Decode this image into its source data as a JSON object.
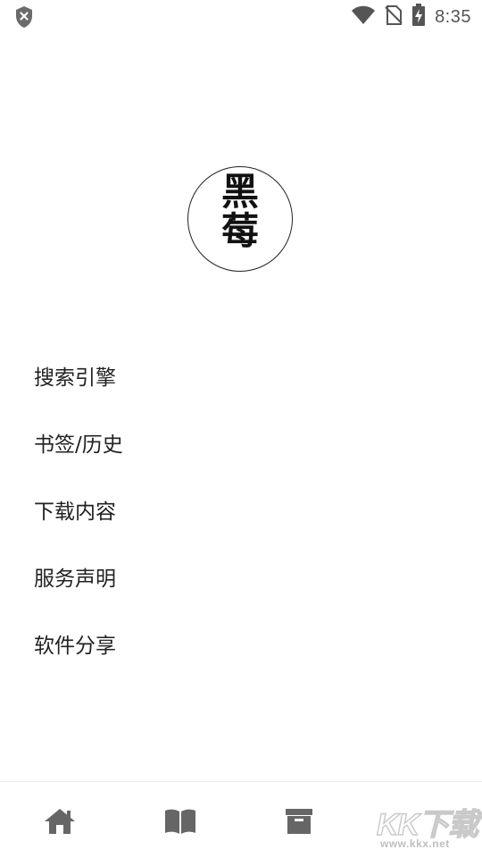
{
  "status_bar": {
    "time": "8:35",
    "left_icon": "shield-x-icon",
    "icons": [
      "wifi-icon",
      "no-sim-icon",
      "battery-charging-icon"
    ]
  },
  "logo": {
    "line1": "黑",
    "line2": "莓"
  },
  "menu": {
    "items": [
      {
        "label": "搜索引擎"
      },
      {
        "label": "书签/历史"
      },
      {
        "label": "下载内容"
      },
      {
        "label": "服务声明"
      },
      {
        "label": "软件分享"
      }
    ]
  },
  "bottom_nav": {
    "items": [
      {
        "icon": "home-icon"
      },
      {
        "icon": "book-icon"
      },
      {
        "icon": "archive-icon"
      }
    ]
  },
  "watermark": {
    "brand": "KK下载",
    "url": "www.kkx.net"
  },
  "colors": {
    "icon_gray": "#666666",
    "text": "#222222",
    "background": "#ffffff"
  }
}
